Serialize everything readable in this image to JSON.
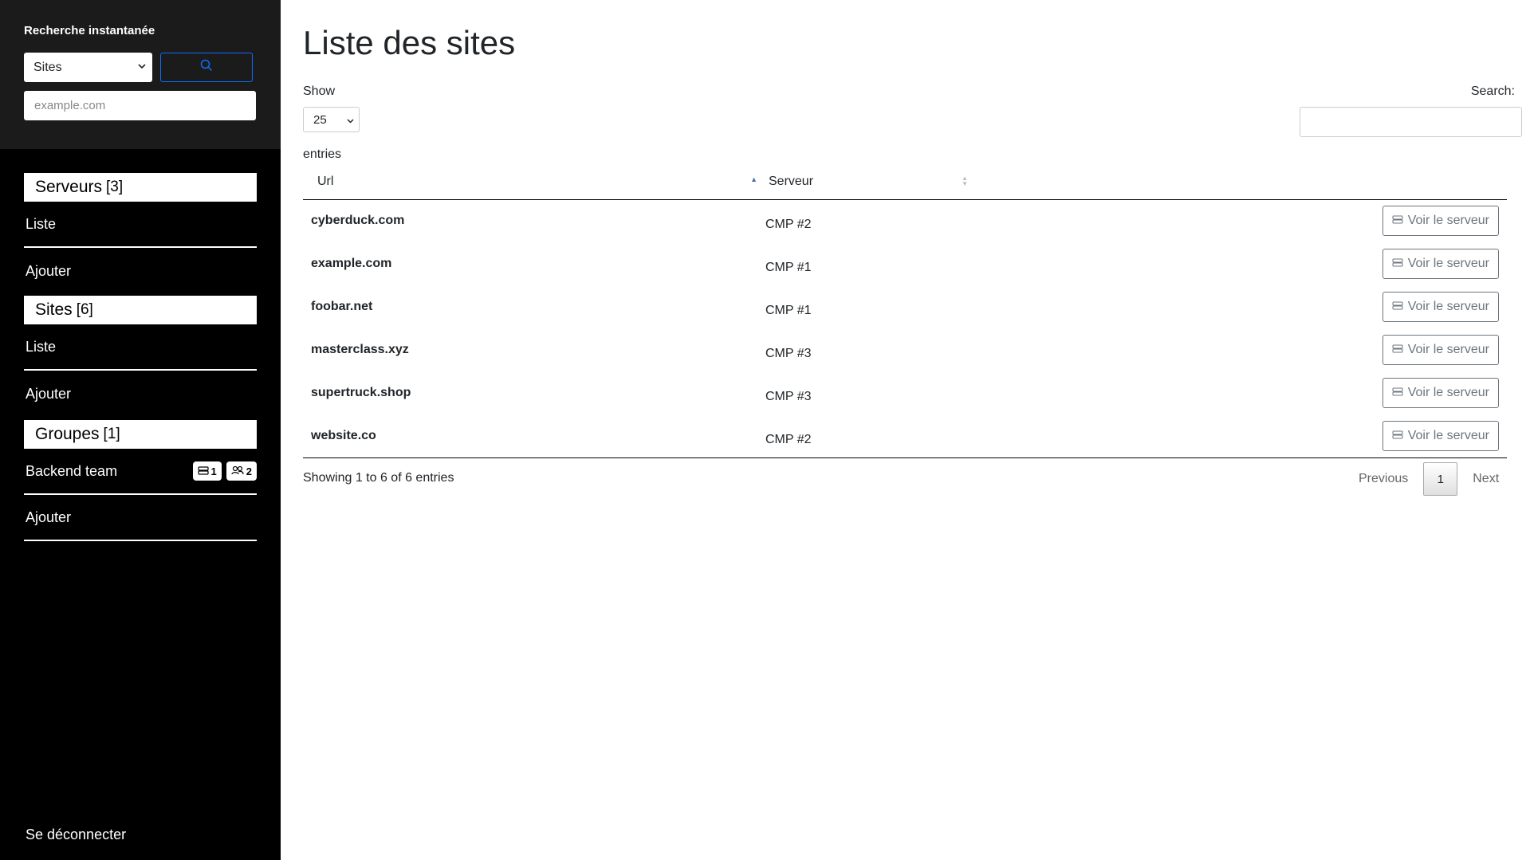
{
  "sidebar": {
    "search_title": "Recherche instantanée",
    "search_select": "Sites",
    "search_placeholder": "example.com",
    "sections": [
      {
        "title": "Serveurs",
        "count": "[3]",
        "items": [
          "Liste",
          "Ajouter"
        ]
      },
      {
        "title": "Sites",
        "count": "[6]",
        "items": [
          "Liste",
          "Ajouter"
        ]
      },
      {
        "title": "Groupes",
        "count": "[1]",
        "group_name": "Backend team",
        "group_servers": "1",
        "group_users": "2",
        "add_label": "Ajouter"
      }
    ],
    "logout": "Se déconnecter"
  },
  "main": {
    "title": "Liste des sites",
    "show_label": "Show",
    "page_length": "25",
    "entries_label": "entries",
    "search_label": "Search:",
    "columns": [
      "Url",
      "Serveur"
    ],
    "rows": [
      {
        "url": "cyberduck.com",
        "server": "CMP #2",
        "action": "Voir le serveur"
      },
      {
        "url": "example.com",
        "server": "CMP #1",
        "action": "Voir le serveur"
      },
      {
        "url": "foobar.net",
        "server": "CMP #1",
        "action": "Voir le serveur"
      },
      {
        "url": "masterclass.xyz",
        "server": "CMP #3",
        "action": "Voir le serveur"
      },
      {
        "url": "supertruck.shop",
        "server": "CMP #3",
        "action": "Voir le serveur"
      },
      {
        "url": "website.co",
        "server": "CMP #2",
        "action": "Voir le serveur"
      }
    ],
    "info": "Showing 1 to 6 of 6 entries",
    "pagination": {
      "previous": "Previous",
      "current": "1",
      "next": "Next"
    }
  },
  "colors": {
    "sidebar_bg": "#000000",
    "search_panel_bg": "#1b1b1b",
    "accent": "#0d6efd",
    "button_border": "#6c757d"
  },
  "icons": {
    "search": "search-icon",
    "server": "server-icon",
    "users": "users-icon"
  }
}
